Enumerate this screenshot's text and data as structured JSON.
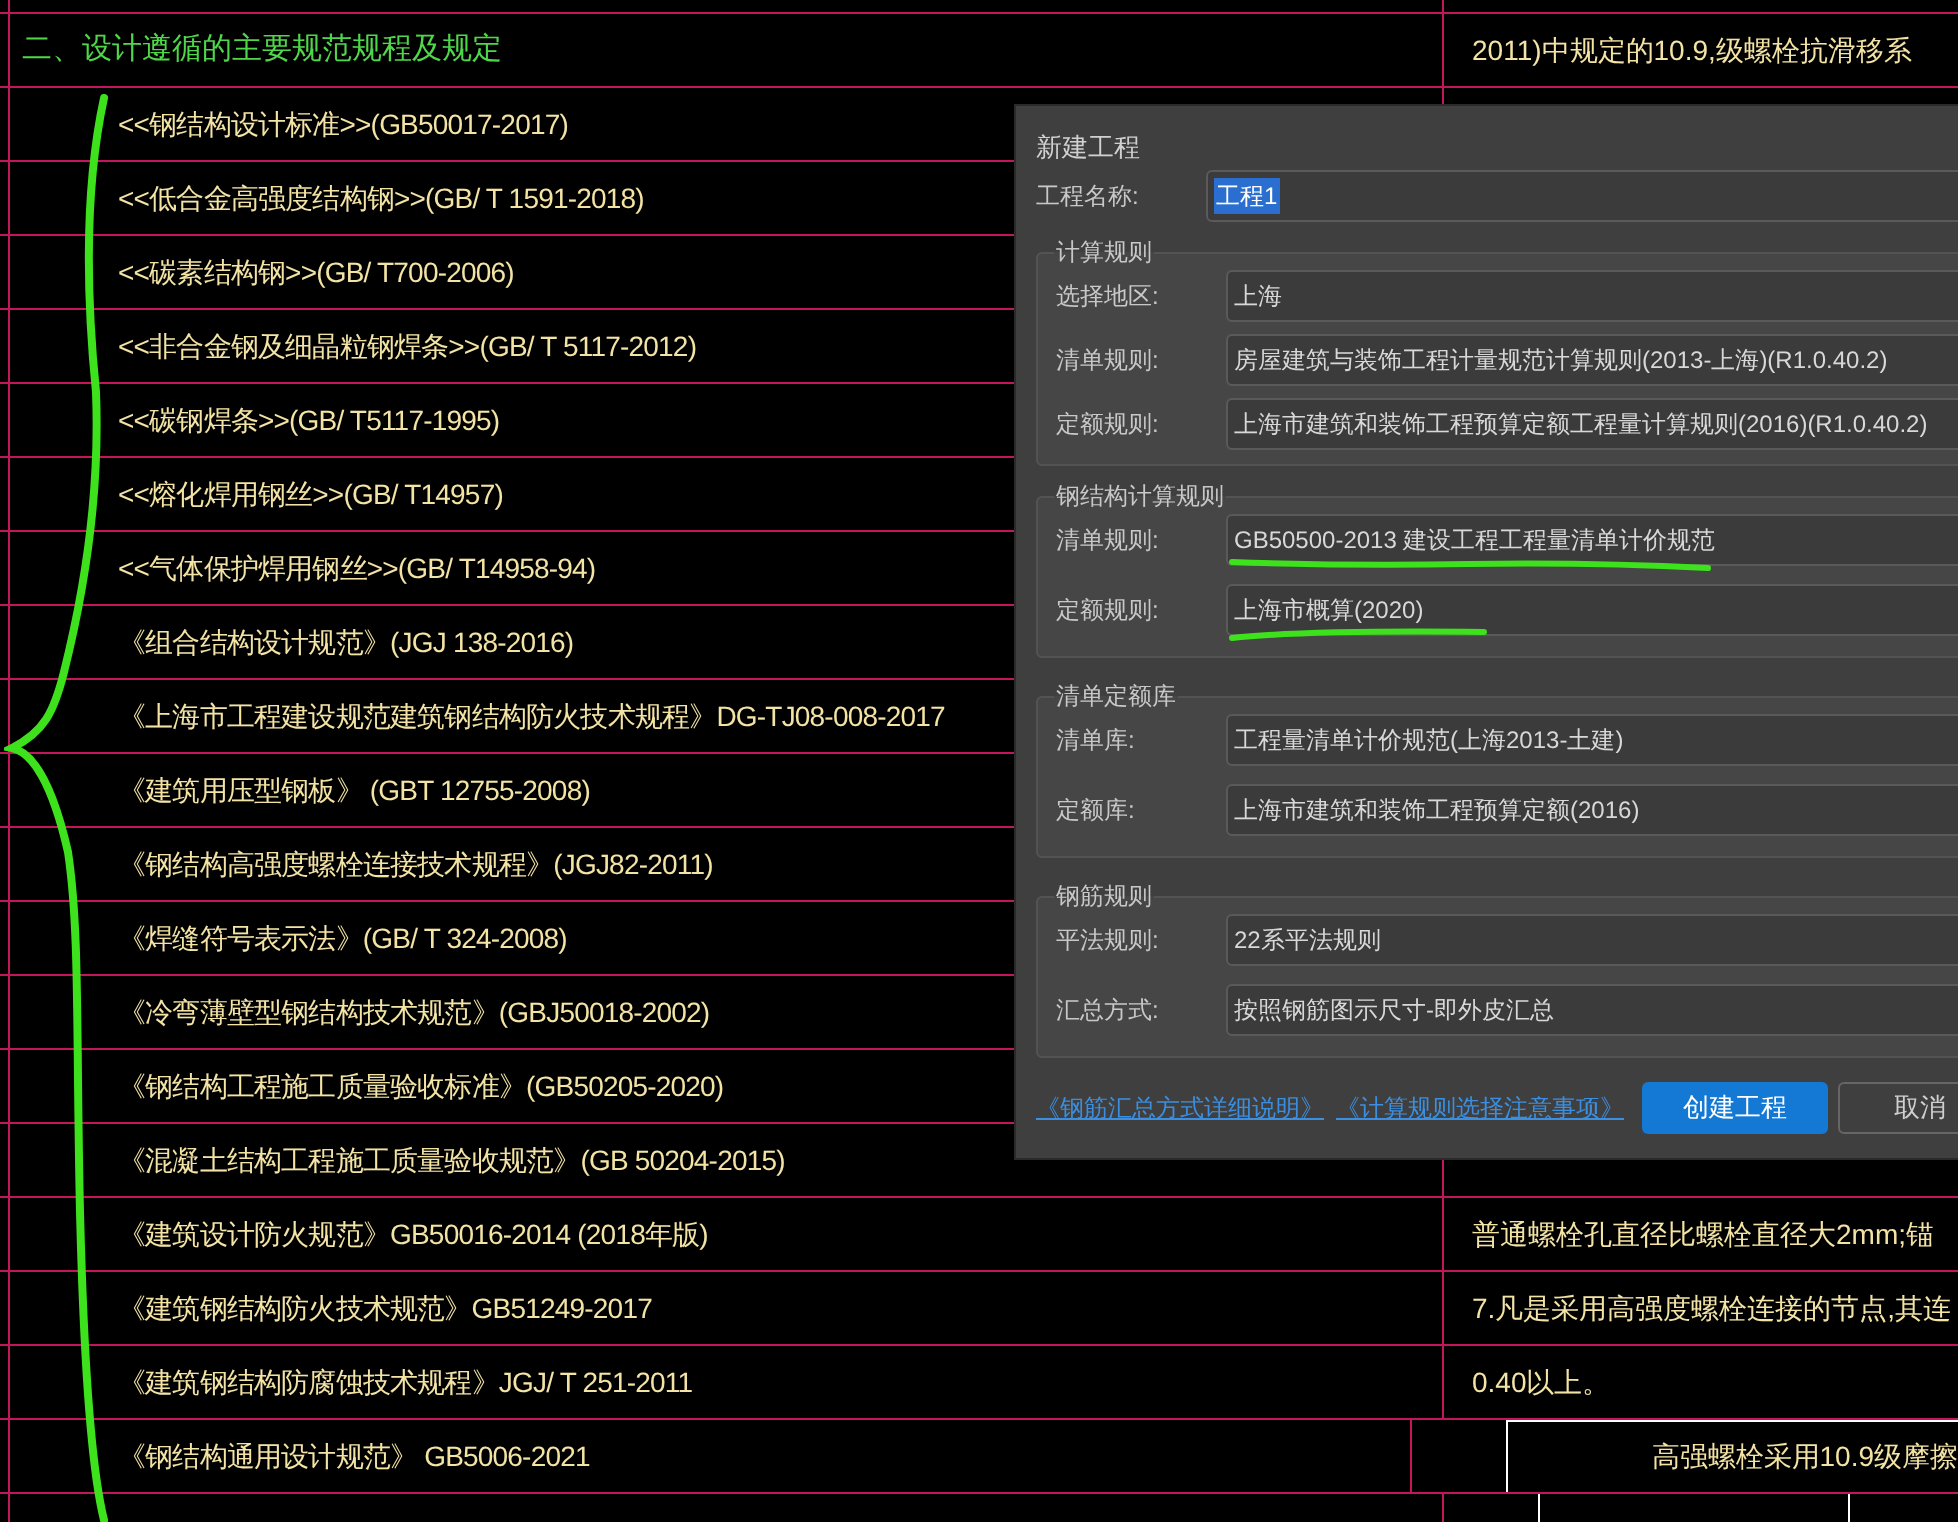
{
  "drawing": {
    "rows": [
      {
        "left": "二、设计遵循的主要规范规程及规定",
        "kind": "heading",
        "right": {
          "kind": "note",
          "text": "2011)中规定的10.9,级螺栓抗滑移系"
        }
      },
      {
        "left": "<<钢结构设计标准>>(GB50017-2017)",
        "kind": "standard"
      },
      {
        "left": "<<低合金高强度结构钢>>(GB/ T 1591-2018)",
        "kind": "standard"
      },
      {
        "left": "<<碳素结构钢>>(GB/ T700-2006)",
        "kind": "standard"
      },
      {
        "left": "<<非合金钢及细晶粒钢焊条>>(GB/ T 5117-2012)",
        "kind": "standard"
      },
      {
        "left": "<<碳钢焊条>>(GB/ T5117-1995)",
        "kind": "standard"
      },
      {
        "left": "<<熔化焊用钢丝>>(GB/ T14957)",
        "kind": "standard"
      },
      {
        "left": "<<气体保护焊用钢丝>>(GB/ T14958-94)",
        "kind": "standard"
      },
      {
        "left": "《组合结构设计规范》(JGJ 138-2016)",
        "kind": "standard"
      },
      {
        "left": "《上海市工程建设规范建筑钢结构防火技术规程》DG-TJ08-008-2017",
        "kind": "standard"
      },
      {
        "left": "《建筑用压型钢板》 (GBT 12755-2008)",
        "kind": "standard"
      },
      {
        "left": "《钢结构高强度螺栓连接技术规程》(JGJ82-2011)",
        "kind": "standard"
      },
      {
        "left": "《焊缝符号表示法》(GB/ T 324-2008)",
        "kind": "standard"
      },
      {
        "left": "《冷弯薄壁型钢结构技术规范》(GBJ50018-2002)",
        "kind": "standard"
      },
      {
        "left": "《钢结构工程施工质量验收标准》(GB50205-2020)",
        "kind": "standard"
      },
      {
        "left": "《混凝土结构工程施工质量验收规范》(GB 50204-2015)",
        "kind": "standard"
      },
      {
        "left": "《建筑设计防火规范》GB50016-2014 (2018年版)",
        "kind": "standard",
        "right": {
          "kind": "note",
          "text": "普通螺栓孔直径比螺栓直径大2mm;锚"
        }
      },
      {
        "left": "《建筑钢结构防火技术规范》GB51249-2017",
        "kind": "standard",
        "right": {
          "kind": "note",
          "text": "7.凡是采用高强度螺栓连接的节点,其连"
        }
      },
      {
        "left": "《建筑钢结构防腐蚀技术规程》JGJ/ T 251-2011",
        "kind": "standard",
        "right": {
          "kind": "note",
          "text": "0.40以上。"
        }
      },
      {
        "left": "《钢结构通用设计规范》 GB5006-2021",
        "kind": "standard",
        "right": {
          "kind": "boxed",
          "text": "高强螺栓采用10.9级摩擦"
        }
      }
    ]
  },
  "dialog": {
    "title": "新建工程",
    "name_label": "工程名称:",
    "name_value": "工程1",
    "name_selected": true,
    "groups": [
      {
        "title": "计算规则",
        "fields": [
          {
            "label": "选择地区:",
            "value": "上海",
            "underlined": false
          },
          {
            "label": "清单规则:",
            "value": "房屋建筑与装饰工程计量规范计算规则(2013-上海)(R1.0.40.2)",
            "underlined": false
          },
          {
            "label": "定额规则:",
            "value": "上海市建筑和装饰工程预算定额工程量计算规则(2016)(R1.0.40.2)",
            "underlined": false
          }
        ]
      },
      {
        "title": "钢结构计算规则",
        "fields": [
          {
            "label": "清单规则:",
            "value": "GB50500-2013 建设工程工程量清单计价规范",
            "underlined": true
          },
          {
            "label": "定额规则:",
            "value": "上海市概算(2020)",
            "underlined": true
          }
        ]
      },
      {
        "title": "清单定额库",
        "fields": [
          {
            "label": "清单库:",
            "value": "工程量清单计价规范(上海2013-土建)",
            "underlined": false
          },
          {
            "label": "定额库:",
            "value": "上海市建筑和装饰工程预算定额(2016)",
            "underlined": false
          }
        ]
      },
      {
        "title": "钢筋规则",
        "fields": [
          {
            "label": "平法规则:",
            "value": "22系平法规则",
            "underlined": false
          },
          {
            "label": "汇总方式:",
            "value": "按照钢筋图示尺寸-即外皮汇总",
            "underlined": false
          }
        ]
      }
    ],
    "links": [
      "《钢筋汇总方式详细说明》",
      "《计算规则选择注意事项》"
    ],
    "buttons": [
      {
        "label": "创建工程",
        "primary": true
      },
      {
        "label": "取消",
        "primary": false
      }
    ]
  }
}
